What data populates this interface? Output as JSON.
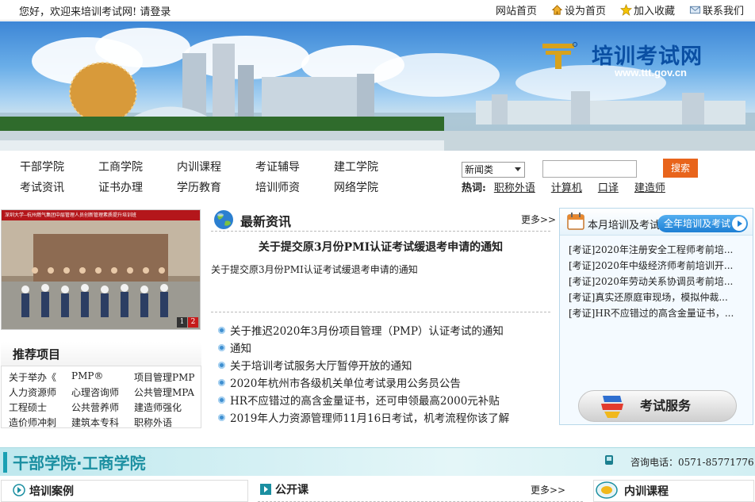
{
  "topbar": {
    "welcome": "您好，欢迎来培训考试网! 请登录",
    "links": [
      "网站首页",
      "设为首页",
      "加入收藏",
      "联系我们"
    ]
  },
  "banner": {
    "site_name": "培训考试网",
    "url": "www.ttt.gov.cn"
  },
  "nav": {
    "row1": [
      "干部学院",
      "工商学院",
      "内训课程",
      "考证辅导",
      "建工学院"
    ],
    "row2": [
      "考试资讯",
      "证书办理",
      "学历教育",
      "培训师资",
      "网络学院"
    ]
  },
  "search": {
    "category": "新闻类",
    "button": "搜索",
    "hot_label": "热词:",
    "hot_words": [
      "职称外语",
      "计算机",
      "口译",
      "建造师"
    ]
  },
  "photo": {
    "caption": "深圳大学--杭州燃气集团中层管理人员创新管理素质提升培训班",
    "pages": [
      "1",
      "2"
    ]
  },
  "recommend": {
    "title": "推荐项目",
    "items": [
      "关于举办《",
      "PMP®",
      "项目管理PMP",
      "人力资源师",
      "心理咨询师",
      "公共管理MPA",
      "工程硕士",
      "公共营养师",
      "建造师强化",
      "造价师冲刺",
      "建筑本专科",
      "职称外语"
    ]
  },
  "news": {
    "title": "最新资讯",
    "more": "更多>>",
    "headline": "关于提交原3月份PMI认证考试缓退考申请的通知",
    "summary": "关于提交原3月份PMI认证考试缓退考申请的通知",
    "list": [
      "关于推迟2020年3月份项目管理（PMP）认证考试的通知",
      "通知",
      "关于培训考试服务大厅暂停开放的通知",
      "2020年杭州市各级机关单位考试录用公务员公告",
      "HR不应错过的高含金量证书，还可申领最高2000元补贴",
      "2019年人力资源管理师11月16日考试，机考流程你该了解"
    ]
  },
  "exam": {
    "label": "本月培训及考试",
    "all_button": "全年培训及考试",
    "list": [
      "[考证]2020年注册安全工程师考前培...",
      "[考证]2020年中级经济师考前培训开...",
      "[考证]2020年劳动关系协调员考前培...",
      "[考证]真实还原庭审现场，模拟仲裁...",
      "[考证]HR不应错过的高含金量证书，..."
    ],
    "service": "考试服务"
  },
  "section": {
    "title": "干部学院·工商学院",
    "phone": "咨询电话：0571-85771776",
    "left": "培训案例",
    "mid": "公开课",
    "mid_more": "更多>>",
    "right": "内训课程"
  }
}
